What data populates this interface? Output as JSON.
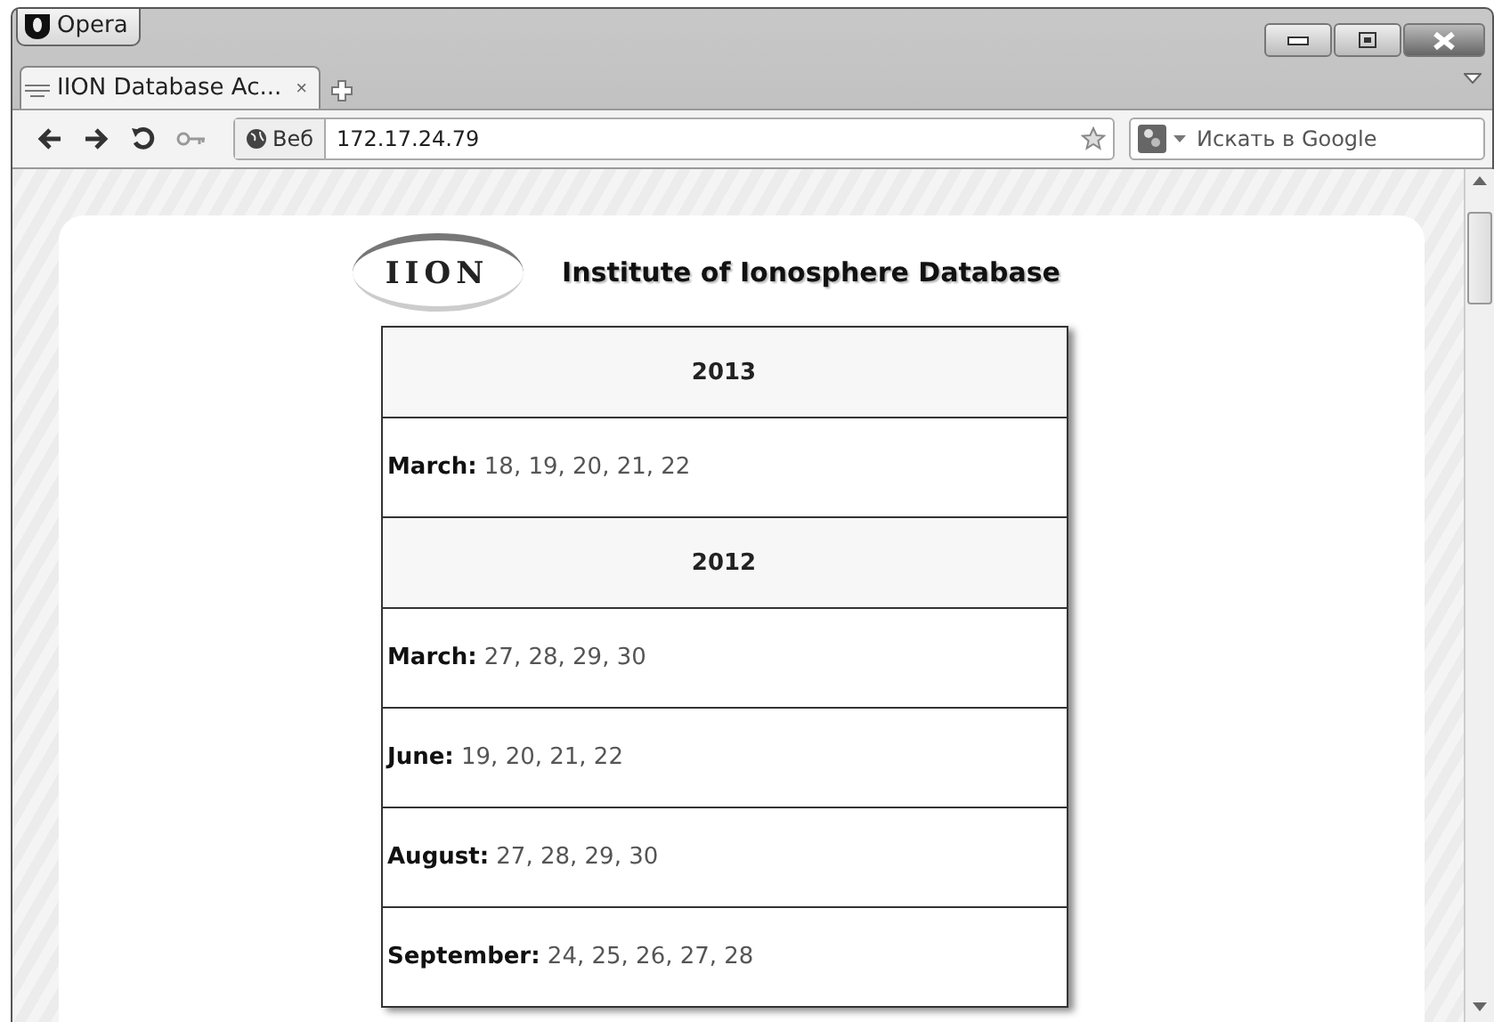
{
  "browser": {
    "menu_button": "Opera",
    "tab": {
      "title": "IION Database Ac...",
      "close": "×"
    },
    "address_badge": "Веб",
    "url": "172.17.24.79",
    "search_placeholder": "Искать в Google"
  },
  "page": {
    "logo_text": "IION",
    "title": "Institute of Ionosphere Database",
    "table": [
      {
        "kind": "year",
        "text": "2013"
      },
      {
        "kind": "entry",
        "text": "**March:** 18, 19, 20, 21, 22"
      },
      {
        "kind": "year",
        "text": "2012"
      },
      {
        "kind": "entry",
        "text": "**March:** 27, 28, 29, 30"
      },
      {
        "kind": "entry",
        "text": "**June:** 19, 20, 21, 22"
      },
      {
        "kind": "entry",
        "text": "**August:** 27, 28, 29, 30"
      },
      {
        "kind": "entry",
        "text": "**September:** 24, 25, 26, 27, 28"
      }
    ]
  }
}
